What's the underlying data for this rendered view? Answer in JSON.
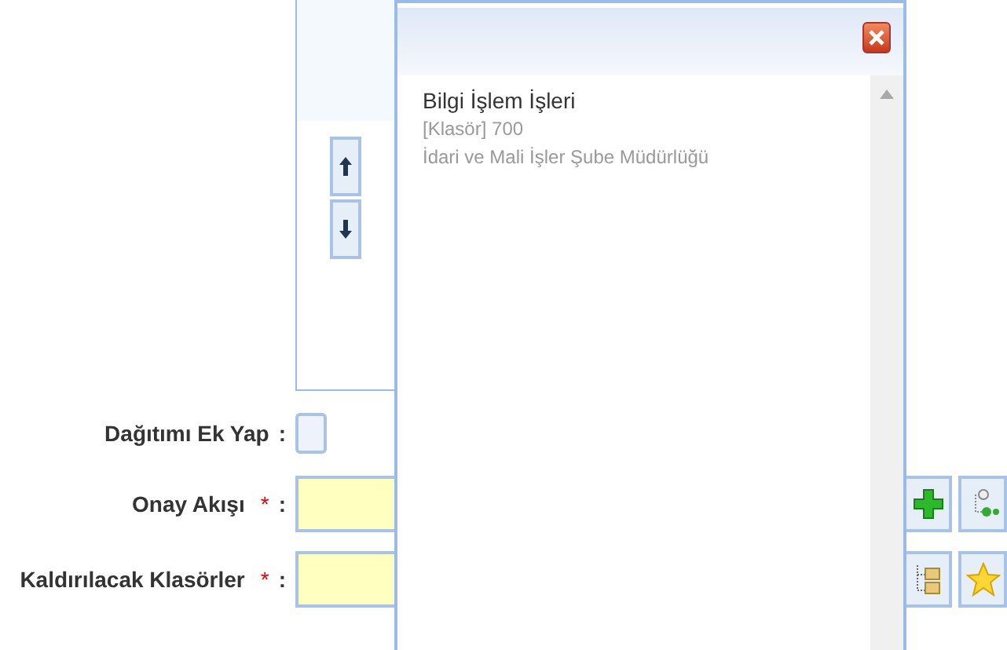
{
  "order_buttons": [
    {
      "kind": "up"
    },
    {
      "kind": "down"
    }
  ],
  "popup": {
    "items": [
      {
        "title": "Bilgi İşlem İşleri",
        "code": "[Klasör] 700",
        "department": "İdari ve Mali İşler Şube Müdürlüğü"
      }
    ]
  },
  "form": {
    "fields": [
      {
        "kind": "checkbox",
        "label": "Dağıtımı Ek Yap",
        "checked": false,
        "separator": ":"
      },
      {
        "kind": "text",
        "label": "Onay Akışı",
        "required_mark": "*",
        "separator": ":",
        "buttons": [
          {
            "kind": "add"
          },
          {
            "kind": "flow"
          }
        ]
      },
      {
        "kind": "text",
        "label": "Kaldırılacak Klasörler",
        "required_mark": "*",
        "separator": ":",
        "buttons": [
          {
            "kind": "tree"
          },
          {
            "kind": "favorite"
          }
        ]
      }
    ]
  }
}
